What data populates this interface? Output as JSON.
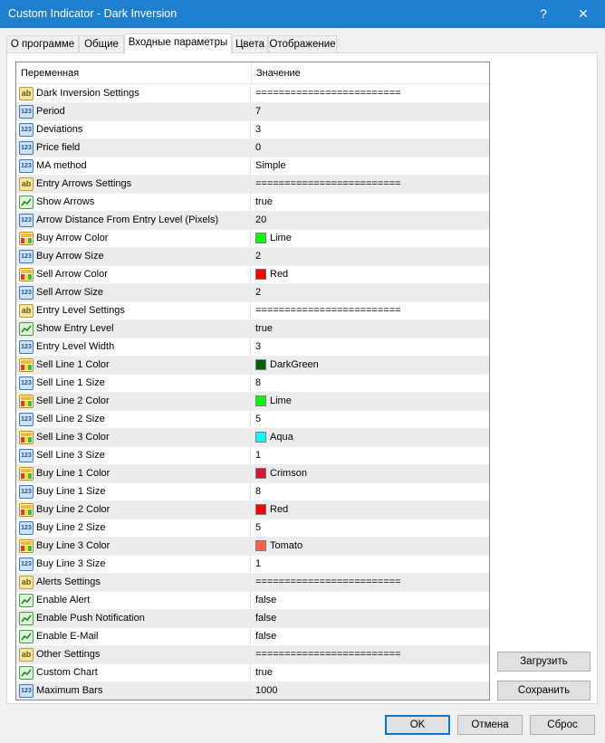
{
  "window": {
    "title": "Custom Indicator - Dark Inversion",
    "help_label": "?",
    "close_label": "✕"
  },
  "tabs": [
    {
      "label": "О программе"
    },
    {
      "label": "Общие"
    },
    {
      "label": "Входные параметры",
      "active": true
    },
    {
      "label": "Цвета"
    },
    {
      "label": "Отображение"
    }
  ],
  "grid": {
    "col_variable": "Переменная",
    "col_value": "Значение",
    "rows": [
      {
        "type": "ab",
        "name": "Dark Inversion Settings",
        "value": "========================="
      },
      {
        "type": "num",
        "name": "Period",
        "value": "7"
      },
      {
        "type": "num",
        "name": "Deviations",
        "value": "3"
      },
      {
        "type": "num",
        "name": "Price field",
        "value": "0"
      },
      {
        "type": "num",
        "name": "MA method",
        "value": "Simple"
      },
      {
        "type": "ab",
        "name": "Entry Arrows Settings",
        "value": "========================="
      },
      {
        "type": "bool",
        "name": "Show Arrows",
        "value": "true"
      },
      {
        "type": "num",
        "name": "Arrow Distance From Entry Level (Pixels)",
        "value": "20"
      },
      {
        "type": "color",
        "name": "Buy Arrow Color",
        "value": "Lime",
        "swatch": "#00ff00"
      },
      {
        "type": "num",
        "name": "Buy Arrow Size",
        "value": "2"
      },
      {
        "type": "color",
        "name": "Sell Arrow Color",
        "value": "Red",
        "swatch": "#ff0000"
      },
      {
        "type": "num",
        "name": "Sell Arrow Size",
        "value": "2"
      },
      {
        "type": "ab",
        "name": "Entry Level Settings",
        "value": "========================="
      },
      {
        "type": "bool",
        "name": "Show Entry Level",
        "value": "true"
      },
      {
        "type": "num",
        "name": "Entry Level Width",
        "value": "3"
      },
      {
        "type": "color",
        "name": "Sell Line 1 Color",
        "value": "DarkGreen",
        "swatch": "#006400"
      },
      {
        "type": "num",
        "name": "Sell Line 1 Size",
        "value": "8"
      },
      {
        "type": "color",
        "name": "Sell Line 2 Color",
        "value": "Lime",
        "swatch": "#00ff00"
      },
      {
        "type": "num",
        "name": "Sell Line 2 Size",
        "value": "5"
      },
      {
        "type": "color",
        "name": "Sell Line 3 Color",
        "value": "Aqua",
        "swatch": "#00ffff"
      },
      {
        "type": "num",
        "name": "Sell Line 3 Size",
        "value": "1"
      },
      {
        "type": "color",
        "name": "Buy Line 1 Color",
        "value": "Crimson",
        "swatch": "#dc143c"
      },
      {
        "type": "num",
        "name": "Buy Line 1 Size",
        "value": "8"
      },
      {
        "type": "color",
        "name": "Buy Line 2 Color",
        "value": "Red",
        "swatch": "#ff0000"
      },
      {
        "type": "num",
        "name": "Buy Line 2 Size",
        "value": "5"
      },
      {
        "type": "color",
        "name": "Buy Line 3 Color",
        "value": "Tomato",
        "swatch": "#ff6347"
      },
      {
        "type": "num",
        "name": "Buy Line 3 Size",
        "value": "1"
      },
      {
        "type": "ab",
        "name": "Alerts Settings",
        "value": "========================="
      },
      {
        "type": "bool",
        "name": "Enable Alert",
        "value": "false"
      },
      {
        "type": "bool",
        "name": "Enable Push Notification",
        "value": "false"
      },
      {
        "type": "bool",
        "name": "Enable E-Mail",
        "value": "false"
      },
      {
        "type": "ab",
        "name": "Other Settings",
        "value": "========================="
      },
      {
        "type": "bool",
        "name": "Custom Chart",
        "value": "true"
      },
      {
        "type": "num",
        "name": "Maximum Bars",
        "value": "1000"
      }
    ]
  },
  "buttons": {
    "load": "Загрузить",
    "save": "Сохранить",
    "ok": "OK",
    "cancel": "Отмена",
    "reset": "Сброс"
  },
  "icons": {
    "ab": "string-param-icon",
    "num": "integer-param-icon",
    "bool": "bool-param-icon",
    "color": "color-param-icon"
  },
  "colors": {
    "titlebar": "#1e7fcf",
    "default_button_border": "#0078d7"
  }
}
